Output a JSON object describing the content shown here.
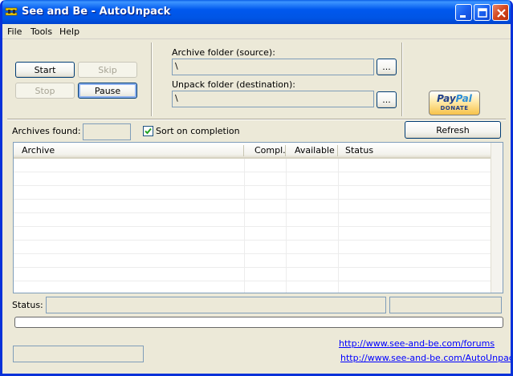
{
  "window": {
    "title": "See and Be - AutoUnpack"
  },
  "menu": {
    "items": [
      "File",
      "Tools",
      "Help"
    ]
  },
  "controls": {
    "start": "Start",
    "skip": "Skip",
    "stop": "Stop",
    "pause": "Pause"
  },
  "source": {
    "label": "Archive folder (source):",
    "value": "\\",
    "browse": "..."
  },
  "destination": {
    "label": "Unpack folder (destination):",
    "value": "\\",
    "browse": "..."
  },
  "paypal": {
    "logo_a": "Pay",
    "logo_b": "Pal",
    "donate": "DONATE"
  },
  "archives": {
    "label": "Archives found:",
    "value": "",
    "sort_label": "Sort on completion",
    "sort_checked": true,
    "refresh": "Refresh"
  },
  "table": {
    "columns": [
      "Archive",
      "Compl.",
      "Available",
      "Status"
    ],
    "rows": []
  },
  "status": {
    "label": "Status:",
    "value": "",
    "secondary": ""
  },
  "progress": {
    "value": 0
  },
  "footer": {
    "field": "",
    "link_forums": "http://www.see-and-be.com/forums",
    "link_autounpack": "http://www.see-and-be.com/AutoUnpack"
  }
}
